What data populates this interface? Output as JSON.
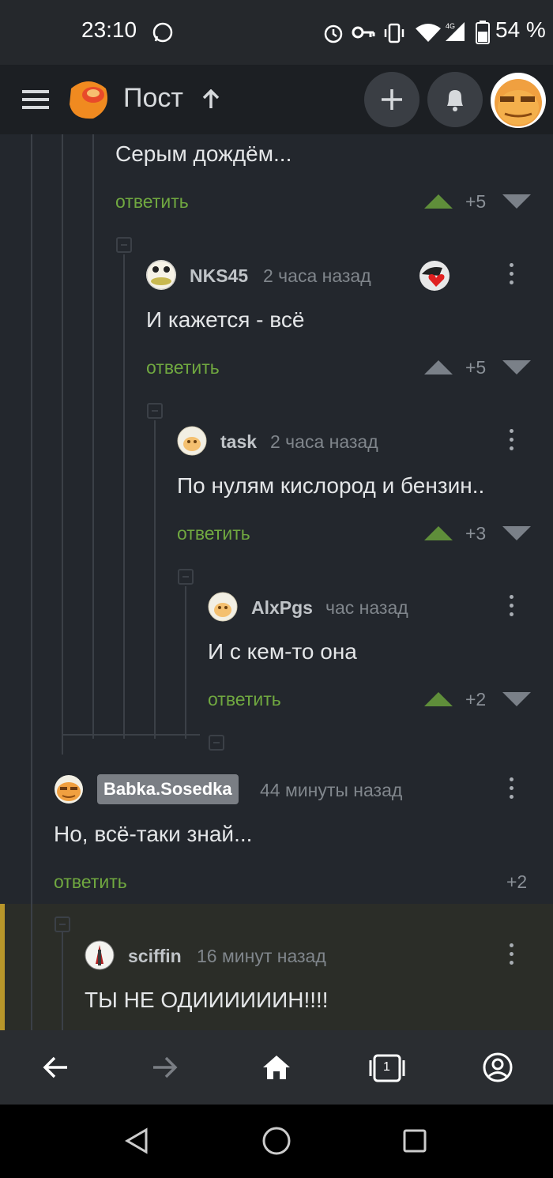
{
  "status_bar": {
    "time": "23:10",
    "battery": "54 %",
    "network": "4G"
  },
  "header": {
    "title": "Пост"
  },
  "comments": [
    {
      "text": "Серым дождём...",
      "reply": "ответить",
      "score": "+5"
    },
    {
      "user": "NKS45",
      "time": "2 часа назад",
      "text": "И кажется - всё",
      "reply": "ответить",
      "score": "+5"
    },
    {
      "user": "task",
      "time": "2 часа назад",
      "text": "По нулям кислород и бензин..",
      "reply": "ответить",
      "score": "+3"
    },
    {
      "user": "AlxPgs",
      "time": "час назад",
      "text": "И с кем-то она",
      "reply": "ответить",
      "score": "+2"
    },
    {
      "user": "Babka.Sosedka",
      "time": "44 минуты назад",
      "text": "Но, всё-таки знай...",
      "reply": "ответить",
      "score": "+2"
    },
    {
      "user": "sciffin",
      "time": "16 минут назад",
      "text": "ТЫ НЕ ОДИИИИИИН!!!!"
    }
  ],
  "bottom_nav": {
    "tabs_count": "1"
  },
  "colors": {
    "reply_green": "#70a840",
    "upvote_green": "#5f8e3a",
    "highlight_border": "#b8962a"
  }
}
